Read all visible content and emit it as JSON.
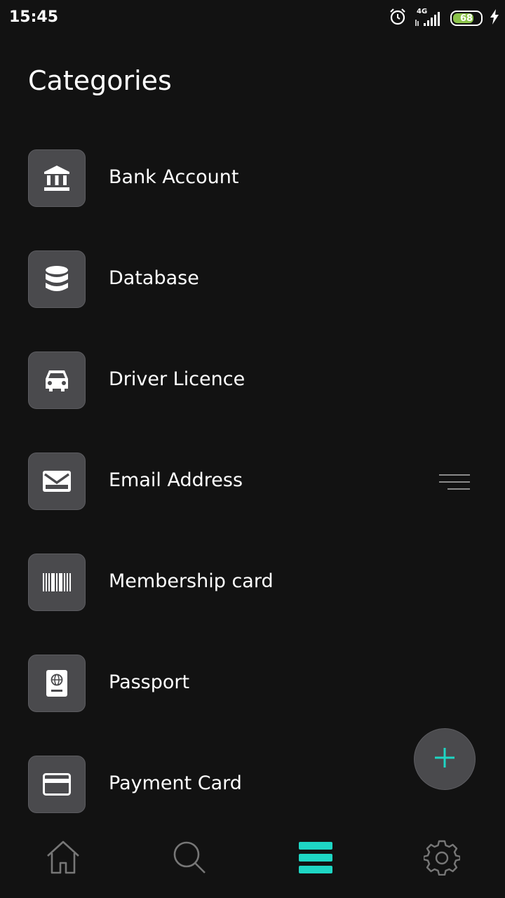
{
  "status_bar": {
    "time": "15:45",
    "network": "4G",
    "battery": "68",
    "icons": [
      "alarm-icon",
      "signal-icon",
      "battery-icon",
      "charging-icon"
    ]
  },
  "page": {
    "title": "Categories"
  },
  "categories": [
    {
      "label": "Bank Account",
      "icon": "bank-icon"
    },
    {
      "label": "Database",
      "icon": "database-icon"
    },
    {
      "label": "Driver Licence",
      "icon": "car-icon"
    },
    {
      "label": "Email Address",
      "icon": "envelope-icon"
    },
    {
      "label": "Membership card",
      "icon": "barcode-icon"
    },
    {
      "label": "Passport",
      "icon": "passport-icon"
    },
    {
      "label": "Payment Card",
      "icon": "credit-card-icon"
    }
  ],
  "fab": {
    "icon": "plus-icon"
  },
  "bottom_nav": {
    "items": [
      {
        "name": "home",
        "icon": "home-icon",
        "active": false
      },
      {
        "name": "search",
        "icon": "search-icon",
        "active": false
      },
      {
        "name": "categories",
        "icon": "list-icon",
        "active": true
      },
      {
        "name": "settings",
        "icon": "gear-icon",
        "active": false
      }
    ]
  },
  "colors": {
    "accent": "#1ed6c4",
    "background": "#121212",
    "tile": "#4a4a4d"
  }
}
